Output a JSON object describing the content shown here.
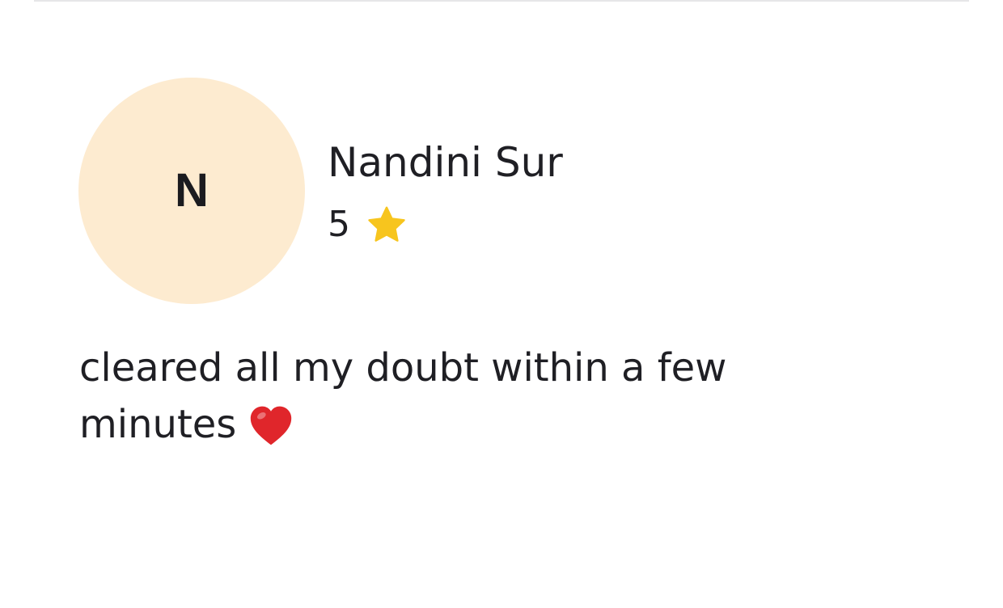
{
  "review": {
    "avatar_initial": "N",
    "reviewer_name": "Nandini Sur",
    "rating": "5",
    "rating_icon": "star-icon",
    "text_line_1": "cleared all my doubt within a few",
    "text_line_2": "minutes",
    "emoji_icon": "heart-icon"
  },
  "colors": {
    "avatar_background": "#FDEBD0",
    "star": "#F7C51E",
    "heart": "#E0262B",
    "text": "#1F1F24",
    "divider": "#E6E6E8"
  }
}
